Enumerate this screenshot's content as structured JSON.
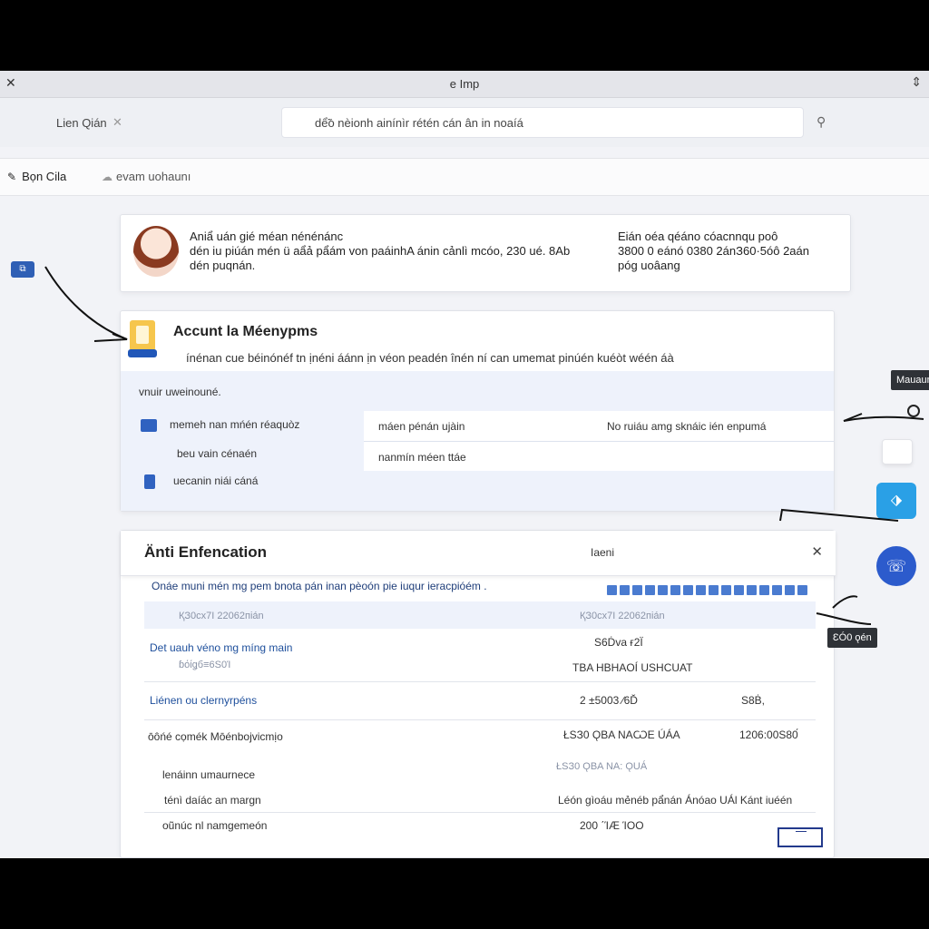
{
  "window": {
    "title": "e Imp",
    "close_glyph": "✕",
    "menu_glyph": "⇕"
  },
  "toolbar": {
    "tab_label": "Lien Qián",
    "tab_close": "✕",
    "search_placeholder": "dể̃o nèionh ainínìr rétén cán ân in noaíá",
    "search_icon": "⚲"
  },
  "nav": {
    "main_label": "Bọn Cila",
    "main_icon": "✎",
    "sub_label": "evam uohaunı",
    "sub_icon": "☁"
  },
  "side_icon": "⧉",
  "info_card": {
    "text_lines": [
      "Aniẩ uán gié méan nénénánc",
      "dén iu piúán mén ü aẩả pẩám von paáinhA ánin cảnlì mcóo, 230 ué. 8Ab",
      "dén puqnán."
    ],
    "right_lines": [
      "Eián oéa qéáno cóacnnqu poô",
      "3800 0 eánó 0380 2ánЗ60·5óô 2aán",
      "póg uoâang"
    ]
  },
  "account_card": {
    "title": "Accunt la Méenypms",
    "description": "ínénan cue béinónéf tn ịnéni áánn ịn véon peadén înén ní can umemat pinúén kuéòt wéén áà",
    "panel_label": "vnuir uweinouné.",
    "rows": [
      {
        "label": "memeh nan mńén réaquòz"
      },
      {
        "label": "beu vain cénaén"
      },
      {
        "label": "uecanin niái cáná"
      }
    ],
    "inner": {
      "cell_1": "máen pénán ujàin",
      "cell_2": "No ruiáu amg sknáic ién enpumá",
      "cell_3": "nanmín méen ttáe"
    }
  },
  "anti_card": {
    "title": "Änti Enfencation",
    "mid_label": "Iaeni",
    "close": "✕",
    "description": "Onáe muni mén mg pem bnota pán inan pèoón pie iuqur ieracpióém .",
    "rows": [
      {
        "left": "ҚЗ0сх7І 22062піán",
        "right": "ҚЗ0сх7І 22062піán"
      },
      {
        "left": "Det uauh véno mg míng main",
        "right": "S6Ḋva ғ2Ї"
      },
      {
        "left": "ɓόίǥб≡6Ѕ0Ί",
        "right": "TBA HBHAOÍ USHCUAT"
      },
      {
        "left": "Liénen ou clernyrpéns",
        "right": "2 ±5003 ∕6Ď",
        "far": "S8Ḃ,"
      },
      {
        "left": "ōôńé cọmék Mōénbojvicmịo",
        "right": "ŁSЗ0 ǪBA NAѠE ÚÁA",
        "far": "1206:00Ѕ80́"
      },
      {
        "left": "lenáinn umaurnece",
        "right": "ŁSЗ0 ǪBA NA: ǪUÁ"
      },
      {
        "left": "ténì daíác an margn",
        "right": "Léón gìoáu mẻnéb pẩnán Ánóao UÁl Kánt iuéén"
      },
      {
        "left": "oũnúc nl namgemeón",
        "right": "200 ΄ΊӔ ΊΟΟ"
      }
    ]
  },
  "floaters": {
    "tooltip_top": "Mauaun",
    "tooltip_bottom": "ƐÓ0 ǫén",
    "blue_icon": "⬗",
    "round_icon": "☏"
  },
  "colors": {
    "accent": "#2f62c0",
    "panel": "#eef2fb",
    "tooltip": "#2f3237"
  }
}
